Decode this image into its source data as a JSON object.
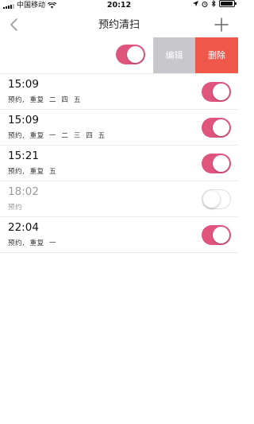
{
  "status_bar": {
    "carrier": "中国移动",
    "time": "20:12",
    "battery_icon": "battery-icon",
    "wifi_icon": "wifi-icon"
  },
  "nav": {
    "title": "预约清扫",
    "back_icon": "chevron-left-icon",
    "add_icon": "plus-icon"
  },
  "master": {
    "enabled": true,
    "edit_label": "编辑",
    "delete_label": "删除"
  },
  "schedules": [
    {
      "time": "15:09",
      "subtitle": "预约,  重复  二  四  五",
      "enabled": true
    },
    {
      "time": "15:09",
      "subtitle": "预约,  重复  一  二  三  四  五",
      "enabled": true
    },
    {
      "time": "15:21",
      "subtitle": "预约,  重复  五",
      "enabled": true
    },
    {
      "time": "18:02",
      "subtitle": "预约",
      "enabled": false
    },
    {
      "time": "22:04",
      "subtitle": "预约,  重复  一",
      "enabled": true
    }
  ],
  "colors": {
    "toggle_on": "#e0557e",
    "delete": "#f0574b",
    "edit": "#c7c7cc"
  }
}
